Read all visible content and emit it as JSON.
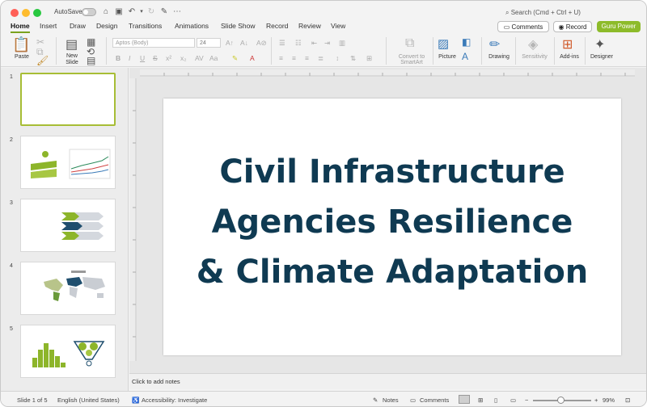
{
  "titlebar": {
    "autosave_label": "AutoSave",
    "search_placeholder": "Search (Cmd + Ctrl + U)"
  },
  "tabs": [
    {
      "label": "Home",
      "active": true
    },
    {
      "label": "Insert"
    },
    {
      "label": "Draw"
    },
    {
      "label": "Design"
    },
    {
      "label": "Transitions"
    },
    {
      "label": "Animations"
    },
    {
      "label": "Slide Show"
    },
    {
      "label": "Record"
    },
    {
      "label": "Review"
    },
    {
      "label": "View"
    }
  ],
  "header_buttons": {
    "comments": "Comments",
    "record": "Record",
    "guru": "Guru Power"
  },
  "ribbon": {
    "paste": "Paste",
    "new_slide_line1": "New",
    "new_slide_line2": "Slide",
    "font_name": "Aptos (Body)",
    "font_size": "24",
    "convert_line1": "Convert to",
    "convert_line2": "SmartArt",
    "picture": "Picture",
    "drawing": "Drawing",
    "sensitivity": "Sensitivity",
    "addins": "Add-ins",
    "designer": "Designer"
  },
  "thumbnails": [
    {
      "number": "1"
    },
    {
      "number": "2"
    },
    {
      "number": "3"
    },
    {
      "number": "4"
    },
    {
      "number": "5"
    }
  ],
  "slide": {
    "title_line1": "Civil Infrastructure",
    "title_line2": "Agencies Resilience",
    "title_line3": "& Climate Adaptation",
    "title_color": "#0f3a52"
  },
  "notes_placeholder": "Click to add notes",
  "status": {
    "slide_count": "Slide 1 of 5",
    "language": "English (United States)",
    "accessibility": "Accessibility: Investigate",
    "notes": "Notes",
    "comments": "Comments",
    "zoom": "99%"
  },
  "colors": {
    "accent_green": "#8dbb2a",
    "tab_underline": "#7aa21f"
  }
}
